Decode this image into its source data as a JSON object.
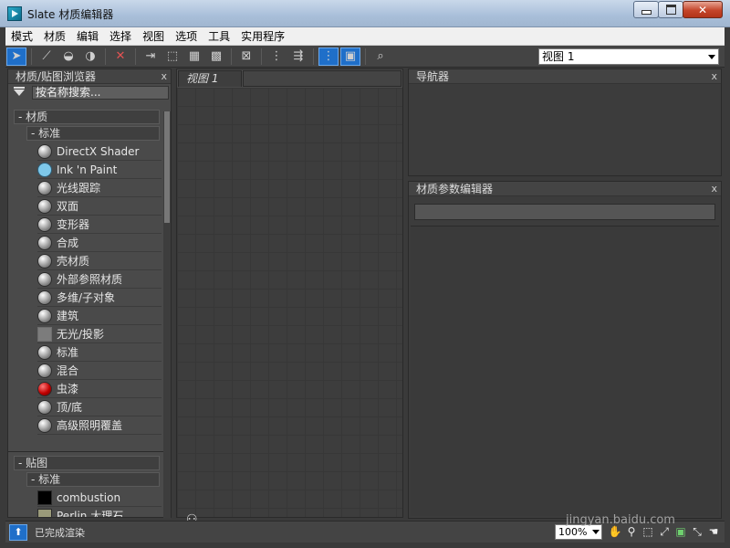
{
  "window": {
    "title": "Slate 材质编辑器"
  },
  "menubar": [
    "模式",
    "材质",
    "编辑",
    "选择",
    "视图",
    "选项",
    "工具",
    "实用程序"
  ],
  "toolbar": {
    "view_select": "视图 1"
  },
  "browser": {
    "title": "材质/贴图浏览器",
    "close": "x",
    "search_placeholder": "按名称搜索...",
    "materials": {
      "label": "- 材质",
      "sub_label": "- 标准",
      "items": [
        {
          "label": "DirectX Shader",
          "swatch": "gray-sphere"
        },
        {
          "label": "Ink 'n Paint",
          "swatch": "light-blue"
        },
        {
          "label": "光线跟踪",
          "swatch": "gray-sphere"
        },
        {
          "label": "双面",
          "swatch": "gray-sphere"
        },
        {
          "label": "变形器",
          "swatch": "gray-sphere"
        },
        {
          "label": "合成",
          "swatch": "gray-sphere"
        },
        {
          "label": "壳材质",
          "swatch": "gray-sphere"
        },
        {
          "label": "外部参照材质",
          "swatch": "white-sphere"
        },
        {
          "label": "多维/子对象",
          "swatch": "gray-sphere"
        },
        {
          "label": "建筑",
          "swatch": "gray-sphere"
        },
        {
          "label": "无光/投影",
          "swatch": "matte-square"
        },
        {
          "label": "标准",
          "swatch": "gray-sphere"
        },
        {
          "label": "混合",
          "swatch": "gray-sphere"
        },
        {
          "label": "虫漆",
          "swatch": "red-sphere"
        },
        {
          "label": "顶/底",
          "swatch": "gray-sphere"
        },
        {
          "label": "高级照明覆盖",
          "swatch": "gray-sphere"
        }
      ]
    },
    "maps": {
      "label": "- 贴图",
      "sub_label": "- 标准",
      "items": [
        {
          "label": "combustion",
          "swatch": "black-square"
        },
        {
          "label": "Perlin 大理石",
          "swatch": "perlin-square"
        }
      ]
    }
  },
  "view": {
    "tab_label": "视图 1"
  },
  "navigator": {
    "title": "导航器",
    "close": "x"
  },
  "param_editor": {
    "title": "材质参数编辑器",
    "close": "x"
  },
  "statusbar": {
    "text": "已完成渲染",
    "zoom": "100%"
  },
  "watermark": "jingyan.baidu.com"
}
